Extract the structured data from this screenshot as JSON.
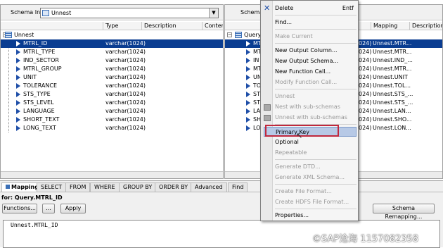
{
  "left_panel": {
    "schema_in_label": "Schema In:",
    "schema_in_value": "Unnest",
    "columns": [
      "Type",
      "Description",
      "Conter"
    ],
    "root_name": "Unnest",
    "rows": [
      {
        "name": "MTRL_ID",
        "type": "varchar(1024)",
        "selected": true
      },
      {
        "name": "MTRL_TYPE",
        "type": "varchar(1024)"
      },
      {
        "name": "IND_SECTOR",
        "type": "varchar(1024)"
      },
      {
        "name": "MTRL_GROUP",
        "type": "varchar(1024)"
      },
      {
        "name": "UNIT",
        "type": "varchar(1024)"
      },
      {
        "name": "TOLERANCE",
        "type": "varchar(1024)"
      },
      {
        "name": "STS_TYPE",
        "type": "varchar(1024)"
      },
      {
        "name": "STS_LEVEL",
        "type": "varchar(1024)"
      },
      {
        "name": "LANGUAGE",
        "type": "varchar(1024)"
      },
      {
        "name": "SHORT_TEXT",
        "type": "varchar(1024)"
      },
      {
        "name": "LONG_TEXT",
        "type": "varchar(1024)"
      }
    ]
  },
  "right_panel": {
    "title_partial": "Schema O",
    "columns": [
      "Mapping",
      "Description"
    ],
    "root_name": "Query",
    "rows": [
      {
        "name": "MTI",
        "type": "024)",
        "mapping": "Unnest.MTR...",
        "selected": true
      },
      {
        "name": "MT",
        "type": "024)",
        "mapping": "Unnest.MTR..."
      },
      {
        "name": "IN",
        "type": "024)",
        "mapping": "Unnest.IND_..."
      },
      {
        "name": "MT",
        "type": "024)",
        "mapping": "Unnest.MTR..."
      },
      {
        "name": "UN",
        "type": "024)",
        "mapping": "Unnest.UNIT"
      },
      {
        "name": "TO",
        "type": "024)",
        "mapping": "Unnest.TOL..."
      },
      {
        "name": "STS",
        "type": "024)",
        "mapping": "Unnest.STS_..."
      },
      {
        "name": "STS",
        "type": "024)",
        "mapping": "Unnest.STS_..."
      },
      {
        "name": "LAN",
        "type": "024)",
        "mapping": "Unnest.LAN..."
      },
      {
        "name": "SHO",
        "type": "024)",
        "mapping": "Unnest.SHO..."
      },
      {
        "name": "LON",
        "type": "024)",
        "mapping": "Unnest.LON..."
      }
    ]
  },
  "bottom": {
    "tabs": [
      "Mapping",
      "SELECT",
      "FROM",
      "WHERE",
      "GROUP BY",
      "ORDER BY",
      "Advanced",
      "Find"
    ],
    "for_label": "for: Query.MTRL_ID",
    "functions_button": "Functions...",
    "ellipsis_button": "...",
    "apply_button": "Apply",
    "schema_remapping_button": "Schema Remapping...",
    "expression": "Unnest.MTRL_ID"
  },
  "context_menu": {
    "items": [
      {
        "label": "Delete",
        "shortcut": "Entf",
        "disabled": false
      },
      {
        "label": "Find...",
        "disabled": false
      },
      {
        "label": "Make Current",
        "disabled": true
      },
      {
        "label": "New Output Column...",
        "disabled": false
      },
      {
        "label": "New Output Schema...",
        "disabled": false
      },
      {
        "label": "New Function Call...",
        "disabled": false
      },
      {
        "label": "Modify Function Call...",
        "disabled": true
      },
      {
        "label": "Unnest",
        "disabled": true
      },
      {
        "label": "Nest with sub-schemas",
        "disabled": true
      },
      {
        "label": "Unnest with sub-schemas",
        "disabled": true
      },
      {
        "label": "Primary Key",
        "disabled": false
      },
      {
        "label": "Optional",
        "disabled": false
      },
      {
        "label": "Repeatable",
        "disabled": true
      },
      {
        "label": "Generate DTD...",
        "disabled": true
      },
      {
        "label": "Generate XML Schema...",
        "disabled": true
      },
      {
        "label": "Create File Format...",
        "disabled": true
      },
      {
        "label": "Create HDFS File Format...",
        "disabled": true
      },
      {
        "label": "Properties...",
        "disabled": false
      }
    ]
  },
  "watermark": "©SAP沧海 1157082358",
  "colors": {
    "selection": "#0a3d91",
    "menu_highlight": "#b7c9e6",
    "highlight_box": "#c0283d"
  }
}
